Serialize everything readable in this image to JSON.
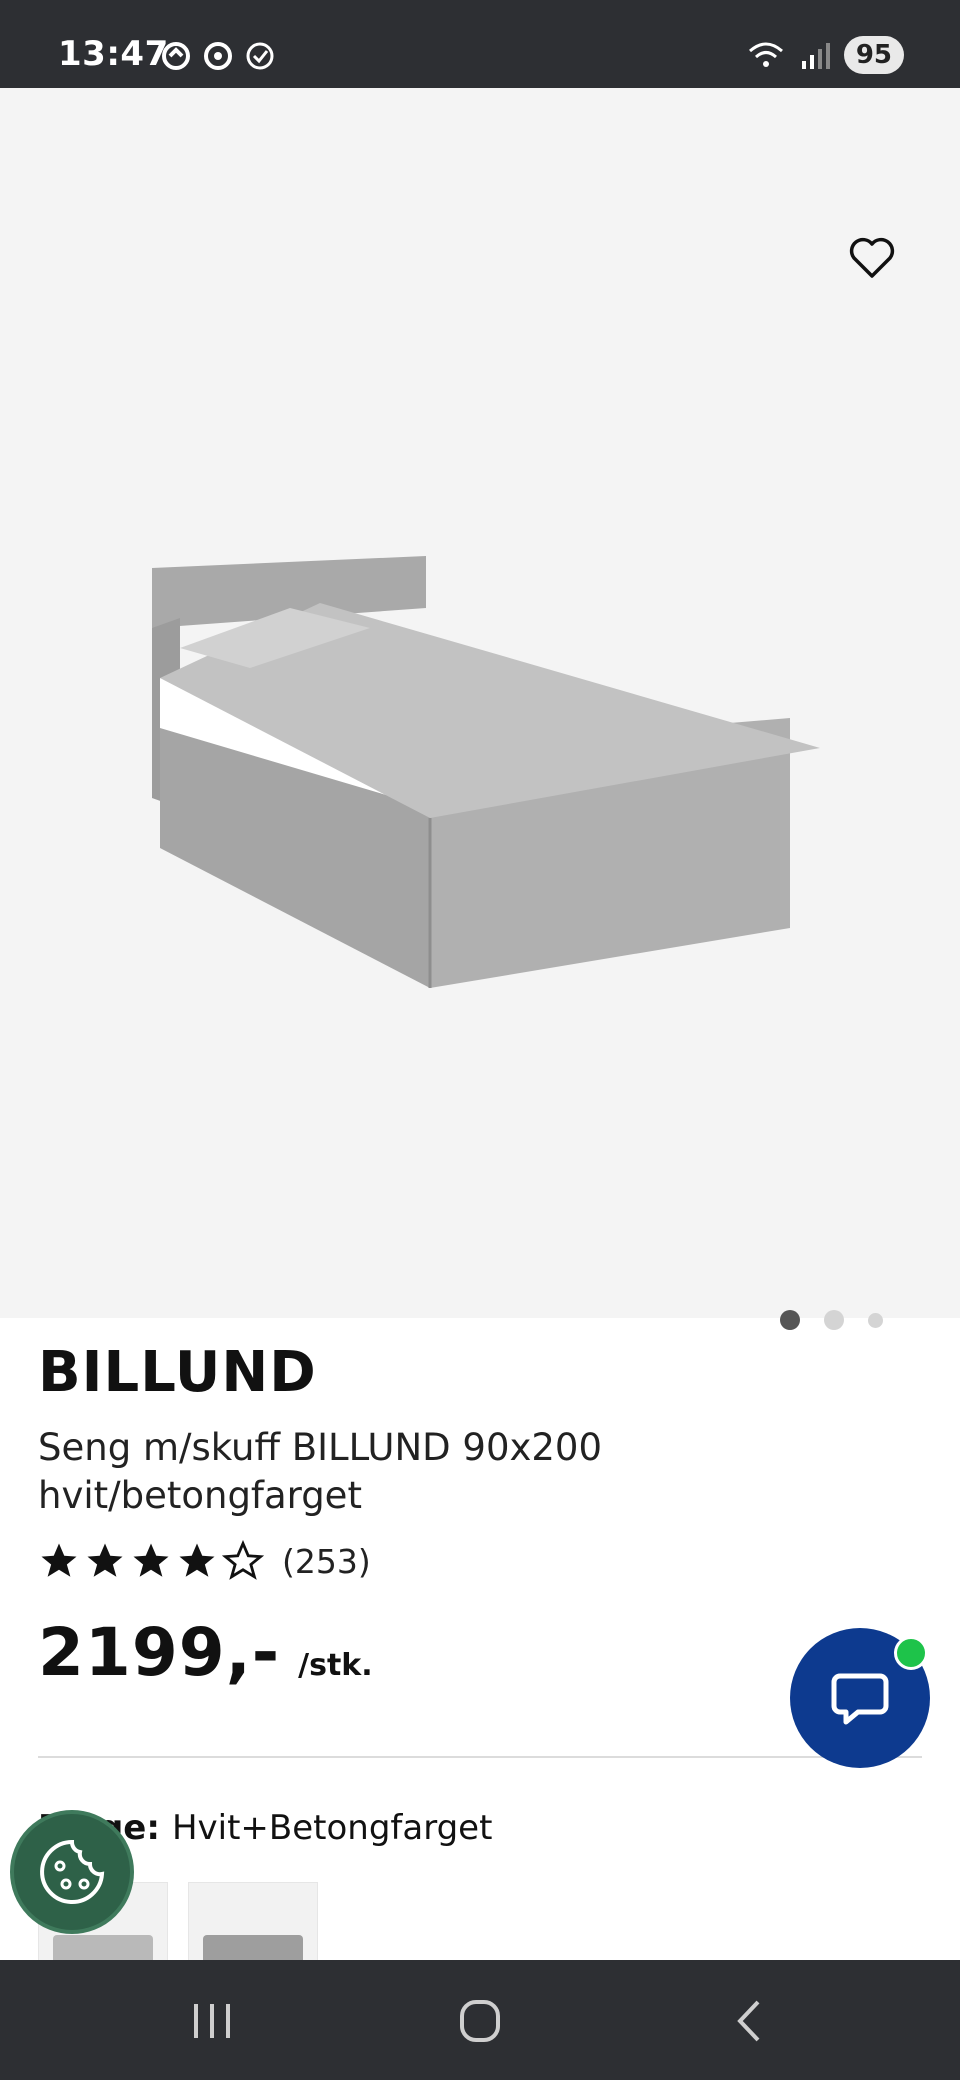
{
  "status_bar": {
    "time": "13:47",
    "battery": "95",
    "left_icons": [
      "sync-icon",
      "vpn-icon",
      "check-circle-icon"
    ],
    "right_icons": [
      "wifi-icon",
      "signal-icon"
    ]
  },
  "gallery": {
    "favorite_icon": "heart-outline-icon",
    "slide_count": 3,
    "active_slide": 1
  },
  "product": {
    "brand": "BILLUND",
    "description": "Seng m/skuff BILLUND 90x200 hvit/betongfarget",
    "rating": 4,
    "rating_max": 5,
    "review_count": "(253)",
    "price": "2199,-",
    "unit": "/stk.",
    "color_label": "Farge:",
    "color_value": "Hvit+Betongfarget"
  },
  "floating": {
    "chat_icon": "chat-bubble-icon",
    "chat_status_color": "#1ec34a",
    "cookie_icon": "cookie-icon"
  },
  "nav_bar": {
    "items": [
      "recent-apps-icon",
      "home-icon",
      "back-icon"
    ]
  },
  "colors": {
    "chat_button": "#0d3a8f",
    "cookie_button": "#2e6148",
    "system_bars": "#2d2f33"
  }
}
